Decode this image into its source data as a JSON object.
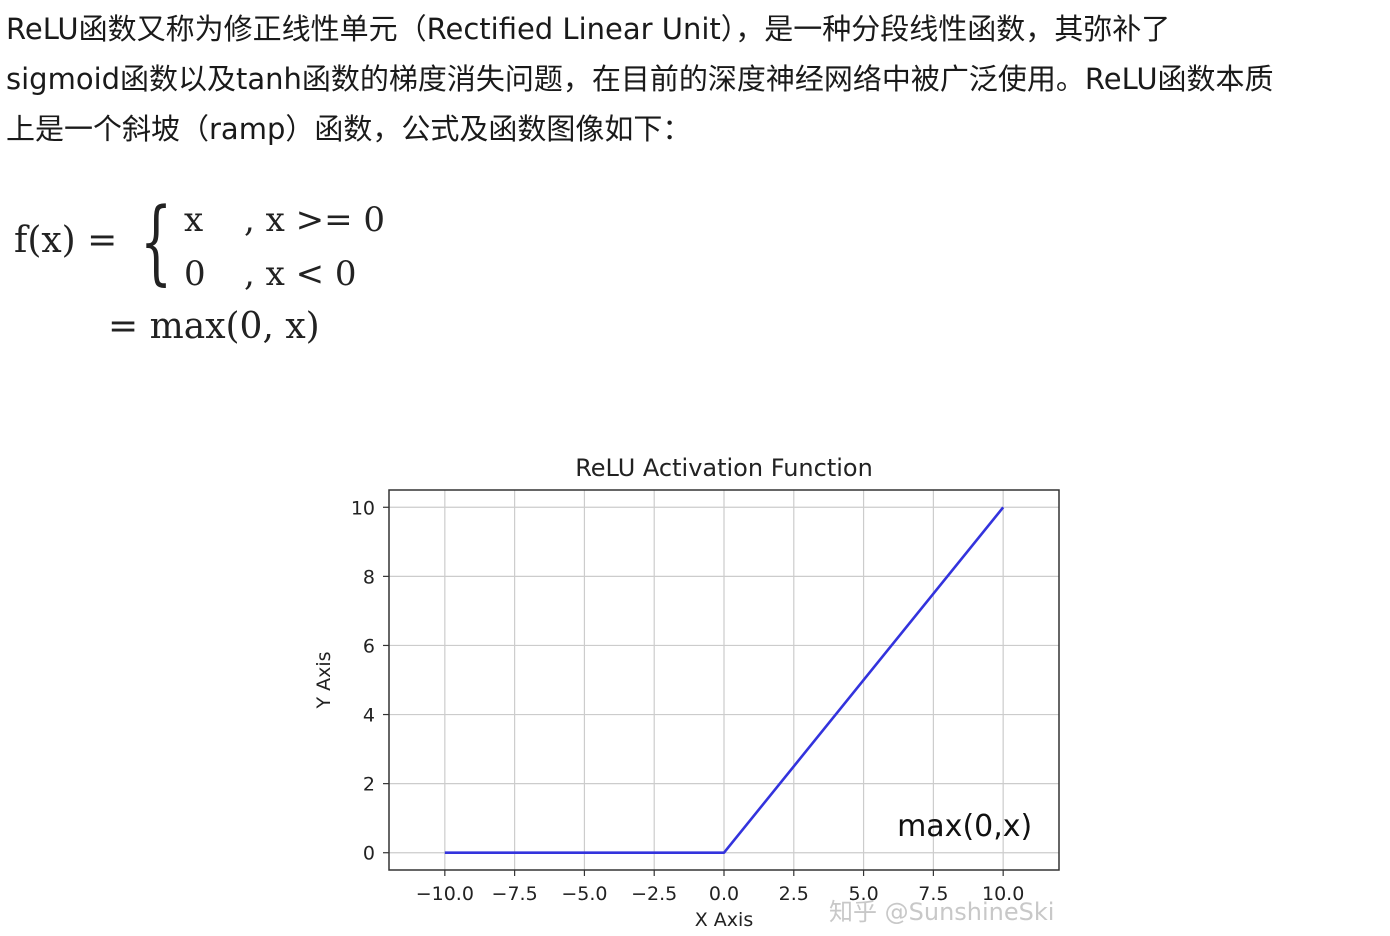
{
  "paragraph": {
    "line1": "ReLU函数又称为修正线性单元（Rectified Linear Unit），是一种分段线性函数，其弥补了",
    "line2": "sigmoid函数以及tanh函数的梯度消失问题，在目前的深度神经网络中被广泛使用。ReLU函数本质",
    "line3": "上是一个斜坡（ramp）函数，公式及函数图像如下："
  },
  "formula": {
    "lhs": "f(x) =",
    "case1_value": "x",
    "case1_condition": ", x >= 0",
    "case2_value": "0",
    "case2_condition": ", x < 0",
    "line2": "= max(0, x)"
  },
  "chart_data": {
    "type": "line",
    "title": "ReLU Activation Function",
    "xlabel": "X Axis",
    "ylabel": "Y Axis",
    "xlim": [
      -12,
      12
    ],
    "ylim": [
      -0.5,
      10.5
    ],
    "x_ticks": [
      -10.0,
      -7.5,
      -5.0,
      -2.5,
      0.0,
      2.5,
      5.0,
      7.5,
      10.0
    ],
    "x_tick_labels": [
      "−10.0",
      "−7.5",
      "−5.0",
      "−2.5",
      "0.0",
      "2.5",
      "5.0",
      "7.5",
      "10.0"
    ],
    "y_ticks": [
      0,
      2,
      4,
      6,
      8,
      10
    ],
    "y_tick_labels": [
      "0",
      "2",
      "4",
      "6",
      "8",
      "10"
    ],
    "grid": true,
    "series": [
      {
        "color": "#3333dd",
        "x": [
          -10,
          0,
          10
        ],
        "y": [
          0,
          0,
          10
        ]
      }
    ],
    "annotation": {
      "text": "max(0,x)",
      "x": 6.2,
      "y": 1.0
    }
  },
  "watermark": "知乎 @SunshineSki"
}
